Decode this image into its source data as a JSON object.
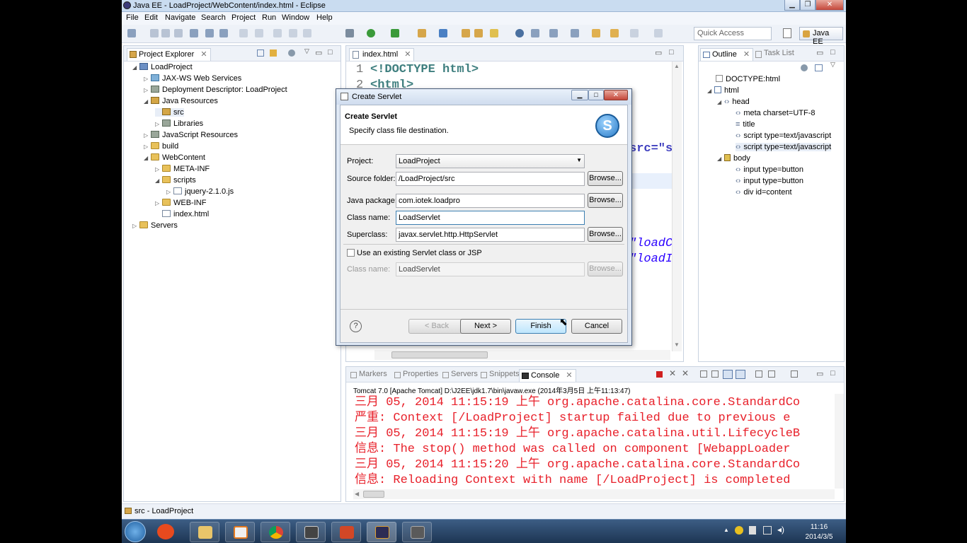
{
  "window": {
    "title": "Java EE - LoadProject/WebContent/index.html - Eclipse"
  },
  "menu": [
    "File",
    "Edit",
    "Navigate",
    "Search",
    "Project",
    "Run",
    "Window",
    "Help"
  ],
  "toolbar": {
    "quick_access_placeholder": "Quick Access",
    "perspective": "Java EE"
  },
  "project_explorer": {
    "tab": "Project Explorer",
    "items": [
      {
        "label": "LoadProject",
        "icon": "project-icon"
      },
      {
        "label": "JAX-WS Web Services",
        "icon": "webservice-icon"
      },
      {
        "label": "Deployment Descriptor: LoadProject",
        "icon": "descriptor-icon"
      },
      {
        "label": "Java Resources",
        "icon": "java-resources-icon"
      },
      {
        "label": "src",
        "icon": "package-folder-icon"
      },
      {
        "label": "Libraries",
        "icon": "library-icon"
      },
      {
        "label": "JavaScript Resources",
        "icon": "javascript-icon"
      },
      {
        "label": "build",
        "icon": "folder-icon"
      },
      {
        "label": "WebContent",
        "icon": "folder-icon"
      },
      {
        "label": "META-INF",
        "icon": "folder-icon"
      },
      {
        "label": "scripts",
        "icon": "folder-icon"
      },
      {
        "label": "jquery-2.1.0.js",
        "icon": "js-file-icon"
      },
      {
        "label": "WEB-INF",
        "icon": "folder-icon"
      },
      {
        "label": "index.html",
        "icon": "html-file-icon"
      },
      {
        "label": "Servers",
        "icon": "servers-icon"
      }
    ]
  },
  "editor": {
    "tab": "index.html",
    "lines": [
      {
        "num": "1",
        "text": "<!DOCTYPE html>"
      },
      {
        "num": "2",
        "text": "<html>"
      }
    ],
    "fragments": [
      "src=\"s",
      "\"loadC",
      "\"loadI",
      "\"\""
    ]
  },
  "outline": {
    "tabs": [
      "Outline",
      "Task List"
    ],
    "items": [
      "DOCTYPE:html",
      "html",
      "head",
      "meta charset=UTF-8",
      "title",
      "script type=text/javascript",
      "script type=text/javascript",
      "body",
      "input type=button",
      "input type=button",
      "div id=content"
    ]
  },
  "console": {
    "tabs": [
      "Markers",
      "Properties",
      "Servers",
      "Snippets",
      "Console"
    ],
    "header": "Tomcat 7.0  [Apache Tomcat] D:\\J2EE\\jdk1.7\\bin\\javaw.exe (2014年3月5日 上午11:13:47)",
    "lines": [
      "三月 05, 2014 11:15:19 上午 org.apache.catalina.core.StandardCo",
      "严重: Context [/LoadProject] startup failed due to previous e",
      "三月 05, 2014 11:15:19 上午 org.apache.catalina.util.LifecycleB",
      "信息: The stop() method was called on component [WebappLoader",
      "三月 05, 2014 11:15:20 上午 org.apache.catalina.core.StandardCo",
      "信息: Reloading Context with name [/LoadProject] is completed"
    ]
  },
  "status": {
    "text": "src - LoadProject"
  },
  "dialog": {
    "title": "Create Servlet",
    "heading": "Create Servlet",
    "subheading": "Specify class file destination.",
    "project_label": "Project:",
    "project_value": "LoadProject",
    "source_folder_label": "Source folder:",
    "source_folder_value": "/LoadProject/src",
    "java_package_label": "Java package:",
    "java_package_value": "com.iotek.loadpro",
    "class_name_label": "Class name:",
    "class_name_value": "LoadServlet",
    "superclass_label": "Superclass:",
    "superclass_value": "javax.servlet.http.HttpServlet",
    "existing_checkbox_label": "Use an existing Servlet class or JSP",
    "existing_class_label": "Class name:",
    "existing_class_value": "LoadServlet",
    "browse_label": "Browse...",
    "back_label": "< Back",
    "next_label": "Next >",
    "finish_label": "Finish",
    "cancel_label": "Cancel",
    "help_glyph": "?"
  },
  "taskbar": {
    "time": "11:16",
    "date": "2014/3/5"
  }
}
